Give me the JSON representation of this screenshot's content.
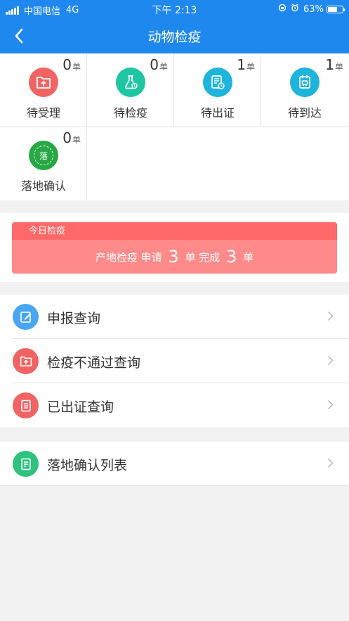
{
  "status_bar": {
    "carrier": "中国电信",
    "network": "4G",
    "time": "下午 2:13",
    "battery": "63%",
    "battery_level": 0.63
  },
  "nav": {
    "title": "动物检疫",
    "back_icon": "chevron-left-icon"
  },
  "colors": {
    "brand": "#1e88ee",
    "today_header": "#ff6969",
    "today_body": "#ff8a8a"
  },
  "tiles": [
    {
      "label": "待受理",
      "count": "0",
      "unit": "单",
      "icon": "folder-upload-icon",
      "color": "#f26363"
    },
    {
      "label": "待检疫",
      "count": "0",
      "unit": "单",
      "icon": "flask-icon",
      "color": "#1ec6a2"
    },
    {
      "label": "待出证",
      "count": "1",
      "unit": "单",
      "icon": "certificate-clock-icon",
      "color": "#1eb4dc"
    },
    {
      "label": "待到达",
      "count": "1",
      "unit": "单",
      "icon": "truck-document-icon",
      "color": "#1eb4dc"
    },
    {
      "label": "落地确认",
      "count": "0",
      "unit": "单",
      "icon": "landing-badge-icon",
      "color": "#27a845",
      "badge_text": "落"
    }
  ],
  "today": {
    "header": "今日检疫",
    "prefix": "产地检疫 申请",
    "applied": "3",
    "unit1": "单",
    "done_label": "完成",
    "completed": "3",
    "unit2": "单"
  },
  "menu": [
    {
      "label": "申报查询",
      "icon": "edit-note-icon",
      "color": "#4aa6f0"
    },
    {
      "label": "检疫不通过查询",
      "icon": "folder-upload-icon",
      "color": "#f26363"
    },
    {
      "label": "已出证查询",
      "icon": "document-list-icon",
      "color": "#f26363"
    },
    {
      "label": "落地确认列表",
      "icon": "checklist-icon",
      "color": "#2ec27e"
    }
  ]
}
